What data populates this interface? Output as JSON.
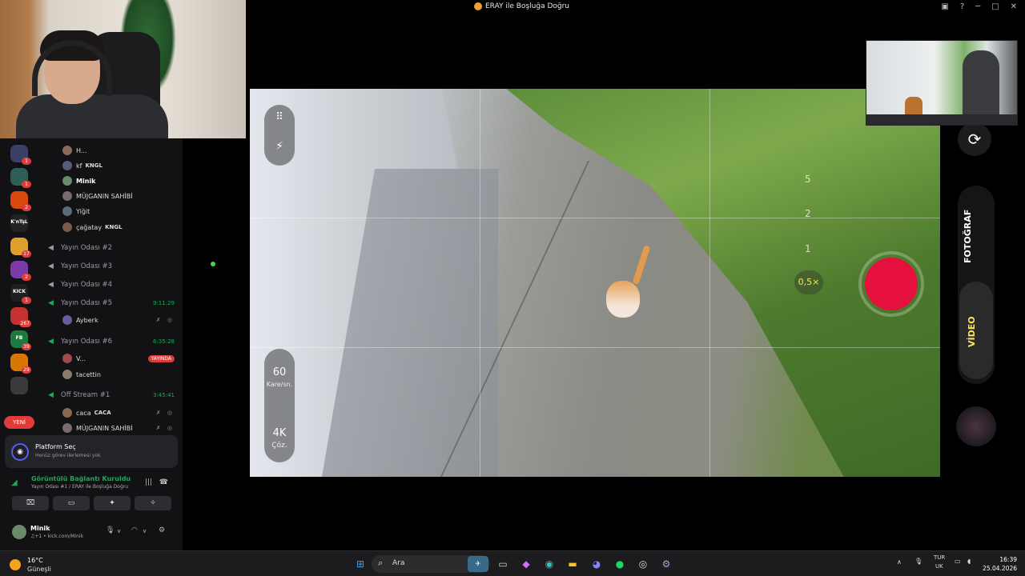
{
  "window": {
    "title": "ERAY ile Boşluğa Doğru",
    "controls": [
      "▣",
      "?",
      "─",
      "□",
      "✕"
    ]
  },
  "discord": {
    "servers": [
      {
        "color": "#3a3f66",
        "badge": "1"
      },
      {
        "color": "#2f5e56",
        "badge": "1"
      },
      {
        "color": "#d9480f",
        "badge": "2"
      },
      {
        "color": "#222222",
        "badge": "",
        "label": "K'nTşL"
      },
      {
        "color": "#e0a030",
        "badge": "17"
      },
      {
        "color": "#7a3aa8",
        "badge": "2"
      },
      {
        "color": "#1f1f1f",
        "badge": "1",
        "label": "KICK"
      },
      {
        "color": "#c53030",
        "badge": "267"
      },
      {
        "color": "#1e7a3c",
        "badge": "39",
        "label": "FB"
      },
      {
        "color": "#d97706",
        "badge": "29"
      },
      {
        "color": "#3a3a3a",
        "badge": ""
      }
    ],
    "new_label": "YENİ",
    "channel_rows": [
      {
        "kind": "user",
        "name": "H...",
        "avatar": "#8a6a5a"
      },
      {
        "kind": "user",
        "name": "kf",
        "tag": "KNGL",
        "avatar": "#5a5a7a"
      },
      {
        "kind": "user",
        "name": "Minik",
        "bold": true,
        "avatar": "#6a8a6a"
      },
      {
        "kind": "user",
        "name": "MÜJGANIN SAHİBİ",
        "avatar": "#7a6a6a"
      },
      {
        "kind": "user",
        "name": "Yiğit",
        "avatar": "#5a6a7a"
      },
      {
        "kind": "user",
        "name": "çağatay",
        "tag": "KNGL",
        "avatar": "#7a5a4a"
      },
      {
        "kind": "voice",
        "name": "Yayın Odası #2"
      },
      {
        "kind": "voice",
        "name": "Yayın Odası #3"
      },
      {
        "kind": "voice",
        "name": "Yayın Odası #4"
      },
      {
        "kind": "voice",
        "name": "Yayın Odası #5",
        "active": true,
        "time": "9:11:29"
      },
      {
        "kind": "user",
        "name": "Ayberk",
        "avatar": "#6a5aa0",
        "icons": "✗ ◎"
      },
      {
        "kind": "voice",
        "name": "Yayın Odası #6",
        "active": true,
        "time": "6:35:28"
      },
      {
        "kind": "user",
        "name": "V...",
        "avatar": "#a04a4a",
        "live": "YAYINDA"
      },
      {
        "kind": "user",
        "name": "tacettin",
        "avatar": "#8a7a6a"
      },
      {
        "kind": "voice",
        "name": "Off Stream #1",
        "active": true,
        "time": "3:45:41"
      },
      {
        "kind": "user",
        "name": "caca",
        "tag": "CACA",
        "avatar": "#8a6a4a",
        "icons": "✗ ◎"
      },
      {
        "kind": "user",
        "name": "MÜJGANIN SAHİBİ",
        "avatar": "#7a6a6a",
        "icons": "✗ ◎"
      }
    ],
    "platform": {
      "title": "Platform Seç",
      "subtitle": "Henüz görev ilerlemesi yok"
    },
    "voice_connection": {
      "status": "Görüntülü Bağlantı Kuruldu",
      "detail": "Yayın Odası #1 / ERAY ile Boşluğa Doğru"
    },
    "user": {
      "name": "Minik",
      "status": "kick.com/Minik",
      "status_prefix": "♫+1 •"
    }
  },
  "camera_app": {
    "fps_value": "60",
    "fps_label": "Kare/sn.",
    "res_value": "4K",
    "res_label": "Çöz.",
    "zoom_levels": [
      "5",
      "2",
      "1"
    ],
    "zoom_selected": "0,5×",
    "mode_photo": "FOTOĞRAF",
    "mode_video": "VİDEO",
    "record_color": "#e5103e",
    "selected_color": "#f3e36a"
  },
  "taskbar": {
    "temperature": "16°C",
    "condition": "Güneşli",
    "search_placeholder": "Ara",
    "lang1": "TUR",
    "lang2": "UK",
    "time": "16:39",
    "date": "25.04.2026"
  }
}
